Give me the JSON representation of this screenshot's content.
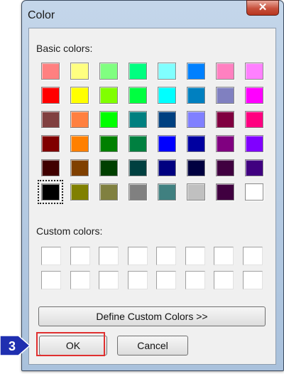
{
  "dialog": {
    "title": "Color",
    "close_glyph": "✕"
  },
  "basic_colors_label": "Basic colors:",
  "basic_colors": [
    [
      "#ff8080",
      "#ffff80",
      "#80ff80",
      "#00ff80",
      "#80ffff",
      "#0080ff",
      "#ff80c0",
      "#ff80ff"
    ],
    [
      "#ff0000",
      "#ffff00",
      "#80ff00",
      "#00ff40",
      "#00ffff",
      "#0080c0",
      "#8080c0",
      "#ff00ff"
    ],
    [
      "#804040",
      "#ff8040",
      "#00ff00",
      "#008080",
      "#004080",
      "#8080ff",
      "#800040",
      "#ff0080"
    ],
    [
      "#800000",
      "#ff8000",
      "#008000",
      "#008040",
      "#0000ff",
      "#0000a0",
      "#800080",
      "#8000ff"
    ],
    [
      "#400000",
      "#804000",
      "#004000",
      "#004040",
      "#000080",
      "#000040",
      "#400040",
      "#400080"
    ],
    [
      "#000000",
      "#808000",
      "#808040",
      "#808080",
      "#408080",
      "#c0c0c0",
      "#400040",
      "#ffffff"
    ]
  ],
  "selected_basic_color": "#000000",
  "custom_colors_label": "Custom colors:",
  "custom_colors": [
    [
      "#ffffff",
      "#ffffff",
      "#ffffff",
      "#ffffff",
      "#ffffff",
      "#ffffff",
      "#ffffff",
      "#ffffff"
    ],
    [
      "#ffffff",
      "#ffffff",
      "#ffffff",
      "#ffffff",
      "#ffffff",
      "#ffffff",
      "#ffffff",
      "#ffffff"
    ]
  ],
  "define_custom_label": "Define Custom Colors >>",
  "ok_label": "OK",
  "cancel_label": "Cancel",
  "step_badge": {
    "number": "3",
    "color": "#1f2fb0",
    "highlight_color": "#e03030"
  }
}
